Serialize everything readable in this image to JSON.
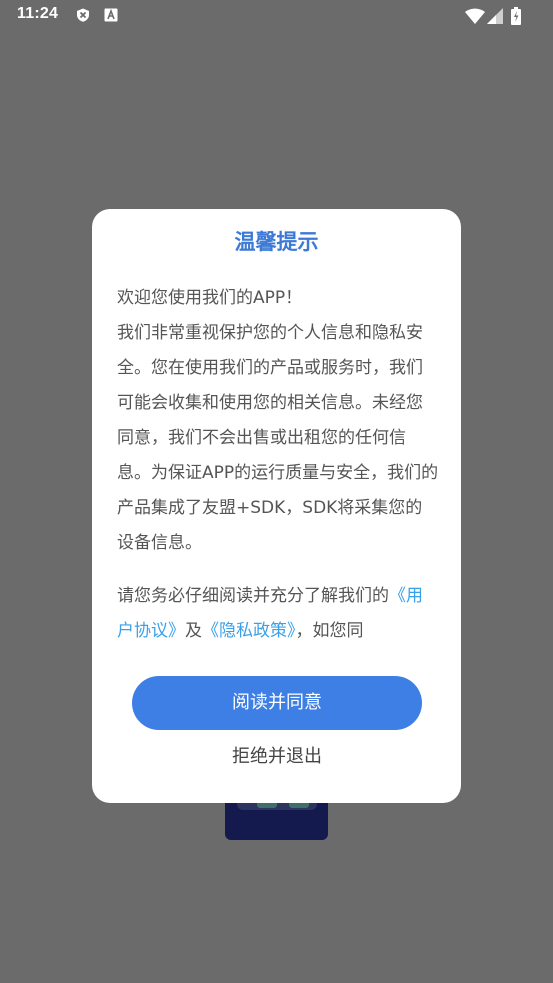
{
  "status_bar": {
    "time": "11:24",
    "left_icons": [
      "shield-x-icon",
      "font-a-icon"
    ],
    "right_icons": [
      "wifi-icon",
      "cellular-signal-icon",
      "battery-icon"
    ]
  },
  "dialog": {
    "title": "温馨提示",
    "body": {
      "line1": "欢迎您使用我们的APP！",
      "para1": "我们非常重视保护您的个人信息和隐私安全。您在使用我们的产品或服务时，我们可能会收集和使用您的相关信息。未经您同意，我们不会出售或出租您的任何信息。为保证APP的运行质量与安全，我们的产品集成了友盟+SDK，SDK将采集您的设备信息。",
      "para2_start": "请您务必仔细阅读并充分了解我们的",
      "user_agreement_link": "《用户协议》",
      "and": "及",
      "privacy_policy_link": "《隐私政策》",
      "para2_end": "，如您同"
    },
    "agree_label": "阅读并同意",
    "reject_label": "拒绝并退出"
  },
  "colors": {
    "accent": "#3d7fe5",
    "title": "#3d7ad6",
    "link": "#3aa0e8",
    "overlay": "#6b6b6b"
  }
}
